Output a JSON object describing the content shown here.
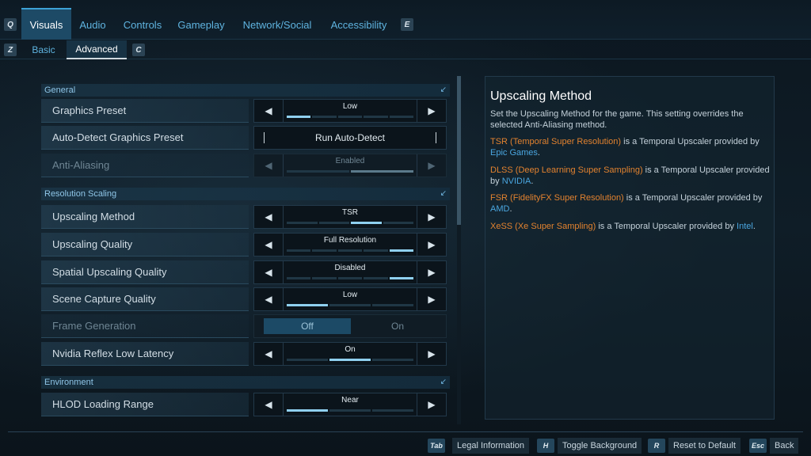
{
  "top_tabs": {
    "left_key": "Q",
    "right_key": "E",
    "items": [
      {
        "label": "Visuals",
        "active": true
      },
      {
        "label": "Audio"
      },
      {
        "label": "Controls"
      },
      {
        "label": "Gameplay"
      },
      {
        "label": "Network/Social"
      },
      {
        "label": "Accessibility"
      }
    ]
  },
  "sub_tabs": {
    "left_key": "Z",
    "right_key": "C",
    "items": [
      {
        "label": "Basic"
      },
      {
        "label": "Advanced",
        "active": true
      }
    ]
  },
  "sections": {
    "general": "General",
    "resolution_scaling": "Resolution Scaling",
    "environment": "Environment"
  },
  "settings": {
    "graphics_preset": {
      "label": "Graphics Preset",
      "value": "Low",
      "level": "1 of 5"
    },
    "auto_detect": {
      "label": "Auto-Detect Graphics Preset",
      "button": "Run Auto-Detect"
    },
    "anti_aliasing": {
      "label": "Anti-Aliasing",
      "value": "Enabled",
      "level": "2 of 2",
      "disabled": true
    },
    "upscaling_method": {
      "label": "Upscaling Method",
      "value": "TSR",
      "level": "3 of 4"
    },
    "upscaling_quality": {
      "label": "Upscaling Quality",
      "value": "Full Resolution",
      "level": "5 of 5"
    },
    "spatial_upscaling_quality": {
      "label": "Spatial Upscaling Quality",
      "value": "Disabled",
      "level": "5 of 5"
    },
    "scene_capture_quality": {
      "label": "Scene Capture Quality",
      "value": "Low",
      "level": "1 of 3"
    },
    "frame_generation": {
      "label": "Frame Generation",
      "off": "Off",
      "on": "On",
      "selected": "Off",
      "disabled": true
    },
    "nvidia_reflex": {
      "label": "Nvidia Reflex Low Latency",
      "value": "On",
      "level": "2 of 3"
    },
    "hlod_loading_range": {
      "label": "HLOD Loading Range",
      "value": "Near",
      "level": "1 of 3"
    }
  },
  "description": {
    "title": "Upscaling Method",
    "intro": "Set the Upscaling Method for the game. This setting overrides the selected Anti-Aliasing method.",
    "tsr_name": "TSR (Temporal Super Resolution)",
    "tsr_mid": " is a Temporal Upscaler provided by ",
    "tsr_vendor": "Epic Games",
    "dlss_name": "DLSS (Deep Learning Super Sampling)",
    "dlss_mid": " is a Temporal Upscaler provided by ",
    "dlss_vendor": "NVIDIA",
    "fsr_name": "FSR (FidelityFX Super Resolution)",
    "fsr_mid": " is a Temporal Upscaler provided by ",
    "fsr_vendor": "AMD",
    "xess_name": "XeSS (Xe Super Sampling)",
    "xess_mid": " is a Temporal Upscaler provided by ",
    "xess_vendor": "Intel",
    "period": "."
  },
  "bottom_bar": {
    "legal": {
      "key": "Tab",
      "label": "Legal Information"
    },
    "toggle_bg": {
      "key": "H",
      "label": "Toggle Background"
    },
    "reset": {
      "key": "R",
      "label": "Reset to Default"
    },
    "back": {
      "key": "Esc",
      "label": "Back"
    }
  },
  "colors": {
    "accent": "#3da2d6",
    "link_blue": "#4aa6e0",
    "highlight_orange": "#e2822f",
    "active_tab_bg": "#1d4a66"
  }
}
